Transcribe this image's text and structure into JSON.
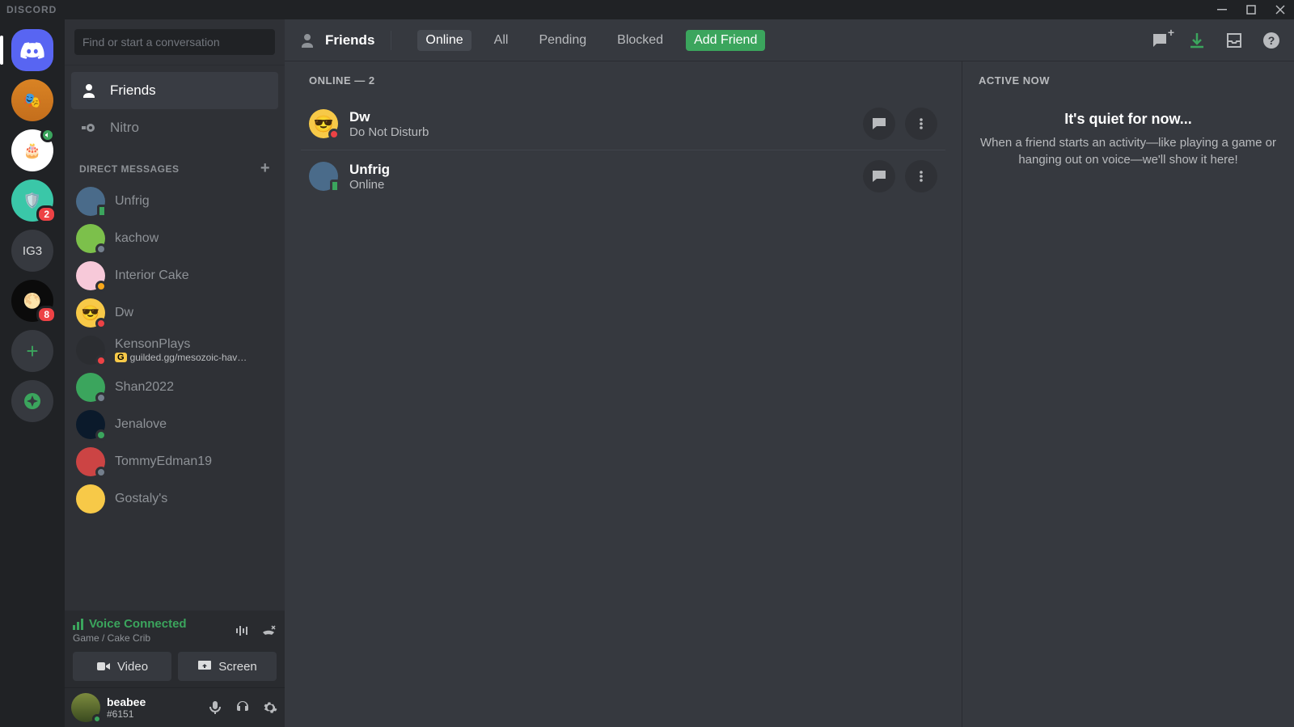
{
  "title_bar": {
    "brand": "DISCORD"
  },
  "guilds": [
    {
      "id": "home",
      "cls": "home selected",
      "label": "",
      "badge": null,
      "voice": false
    },
    {
      "id": "g1",
      "cls": "",
      "bg": "linear-gradient(#d98324,#c46e1c)",
      "emoji": "🎭",
      "badge": null,
      "voice": false
    },
    {
      "id": "g2",
      "cls": "",
      "bg": "#fff",
      "emoji": "🎂",
      "badge": null,
      "voice": true
    },
    {
      "id": "g3",
      "cls": "",
      "bg": "#3ac7a8",
      "emoji": "🛡️",
      "badge": "2",
      "voice": false
    },
    {
      "id": "g4",
      "cls": "",
      "bg": "#36393f",
      "label": "IG3",
      "badge": null,
      "voice": false
    },
    {
      "id": "g5",
      "cls": "",
      "bg": "#0b0b0b",
      "emoji": "🌕",
      "badge": "8",
      "voice": false
    }
  ],
  "sidebar": {
    "search_placeholder": "Find or start a conversation",
    "tabs": {
      "friends": "Friends",
      "nitro": "Nitro"
    },
    "dm_header": "DIRECT MESSAGES",
    "dms": [
      {
        "name": "Unfrig",
        "status": "mobile",
        "bg": "#4a6b8a",
        "emoji": ""
      },
      {
        "name": "kachow",
        "status": "offline",
        "bg": "#7cc04b",
        "emoji": ""
      },
      {
        "name": "Interior Cake",
        "status": "idle",
        "bg": "#f7c9d9",
        "emoji": ""
      },
      {
        "name": "Dw",
        "status": "dnd",
        "bg": "#f7c948",
        "emoji": "😎"
      },
      {
        "name": "KensonPlays",
        "status": "dnd",
        "bg": "#2b2d31",
        "emoji": "",
        "sub": "guilded.gg/mesozoic-hav…",
        "guilded": true
      },
      {
        "name": "Shan2022",
        "status": "offline",
        "bg": "#3ba55d",
        "emoji": ""
      },
      {
        "name": "Jenalove",
        "status": "online",
        "bg": "#0b1a2b",
        "emoji": ""
      },
      {
        "name": "TommyEdman19",
        "status": "offline",
        "bg": "#c44",
        "emoji": ""
      },
      {
        "name": "Gostaly's",
        "status": "",
        "bg": "#f7c948",
        "emoji": ""
      }
    ]
  },
  "voice": {
    "title": "Voice Connected",
    "channel": "Game / Cake Crib",
    "video": "Video",
    "screen": "Screen"
  },
  "user": {
    "name": "beabee",
    "tag": "#6151"
  },
  "topbar": {
    "label": "Friends",
    "tabs": [
      "Online",
      "All",
      "Pending",
      "Blocked"
    ],
    "add": "Add Friend"
  },
  "friends_list": {
    "header": "ONLINE — 2",
    "items": [
      {
        "name": "Dw",
        "status_text": "Do Not Disturb",
        "status": "dnd",
        "bg": "#f7c948",
        "emoji": "😎"
      },
      {
        "name": "Unfrig",
        "status_text": "Online",
        "status": "mobile",
        "bg": "#4a6b8a",
        "emoji": ""
      }
    ]
  },
  "active_now": {
    "title": "ACTIVE NOW",
    "empty_title": "It's quiet for now...",
    "empty_body": "When a friend starts an activity—like playing a game or hanging out on voice—we'll show it here!"
  }
}
